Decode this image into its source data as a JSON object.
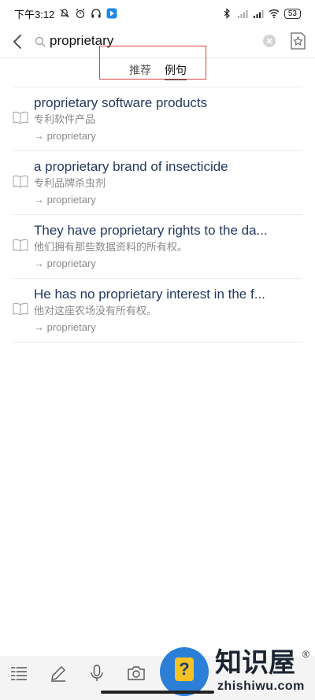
{
  "status_bar": {
    "time": "下午3:12",
    "battery": "53"
  },
  "search": {
    "query": "proprietary"
  },
  "tabs": [
    {
      "label": "推荐"
    },
    {
      "label": "例句"
    }
  ],
  "examples": [
    {
      "en": "proprietary software products",
      "cn": "专利软件产品",
      "source": "→ proprietary"
    },
    {
      "en": "a proprietary brand of insecticide",
      "cn": "专利品牌杀虫剂",
      "source": "→ proprietary"
    },
    {
      "en": "They have proprietary rights to the da...",
      "cn": "他们拥有那些数据资料的所有权。",
      "source": "→ proprietary"
    },
    {
      "en": "He has no proprietary interest in the f...",
      "cn": "他对这座农场没有所有权。",
      "source": "→ proprietary"
    }
  ],
  "watermark": {
    "title": "知识屋",
    "reg": "®",
    "subtitle": "zhishiwu.com",
    "badge": "?"
  },
  "colors": {
    "accent": "#2f4f6f",
    "highlight_box": "#e0443a",
    "example_text": "#23395d",
    "watermark_blue": "#2c7fd6",
    "watermark_yellow": "#f4c224"
  },
  "icons": {
    "back": "chevron-left-icon",
    "search": "search-icon",
    "clear": "clear-icon",
    "favorite": "star-add-icon",
    "book": "book-icon",
    "menu": "list-icon",
    "pen": "pen-icon",
    "mic": "microphone-icon",
    "camera": "camera-icon"
  }
}
